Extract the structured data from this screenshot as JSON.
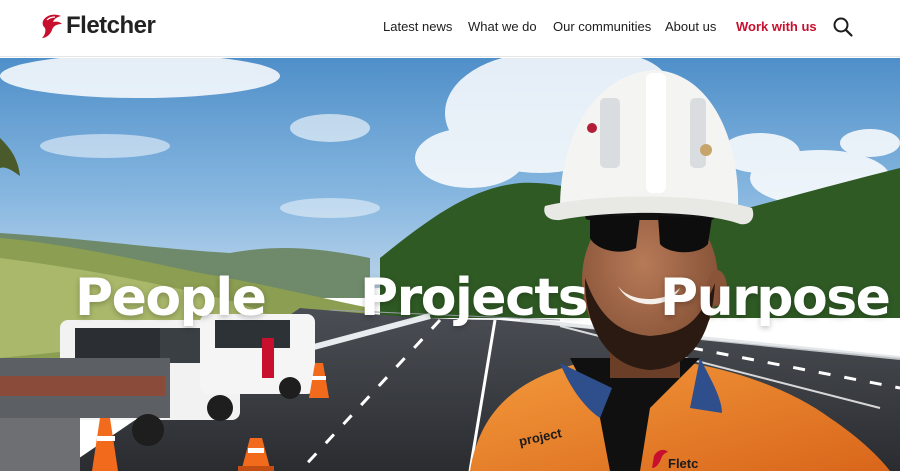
{
  "brand": {
    "name": "Fletcher",
    "accent_color": "#c8102e",
    "text_color": "#222222"
  },
  "nav": {
    "items": [
      {
        "label": "Latest news"
      },
      {
        "label": "What we do"
      },
      {
        "label": "Our communities"
      },
      {
        "label": "About us"
      },
      {
        "label": "Work with us",
        "highlight": true
      }
    ],
    "search_icon": "search-icon"
  },
  "hero": {
    "words": [
      "People",
      "Projects",
      "Purpose"
    ],
    "image": "construction-worker-hard-hat-highway-photo",
    "vest_text": "project",
    "vest_logo_text": "Fletc"
  }
}
